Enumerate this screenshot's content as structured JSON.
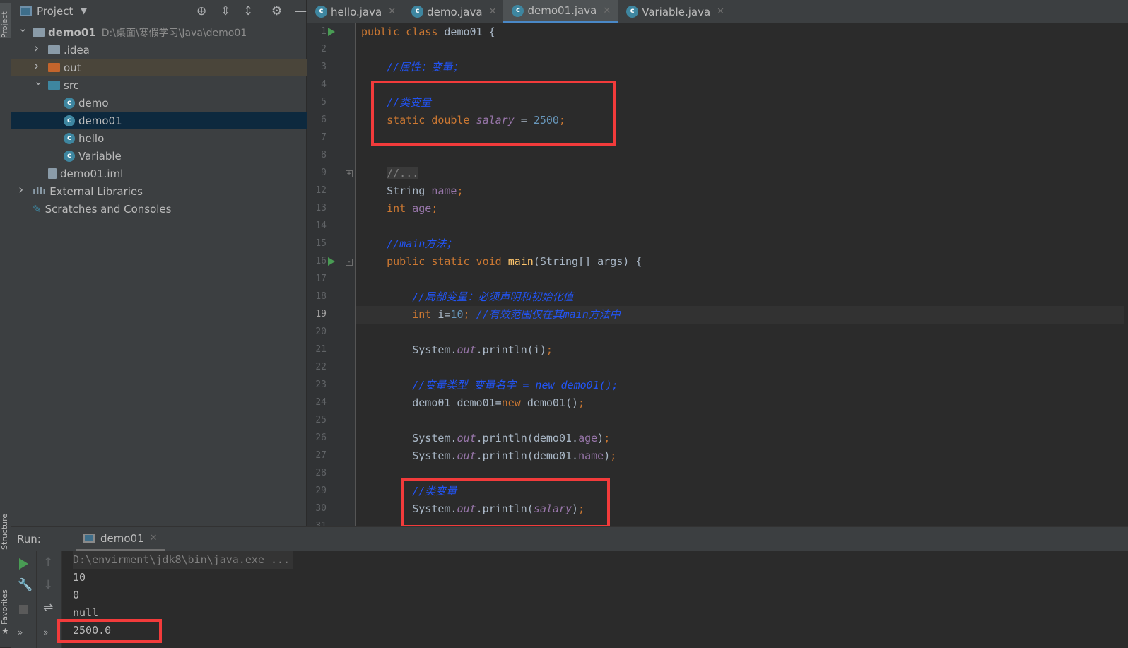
{
  "side_tools": {
    "project": "Project",
    "structure": "Structure",
    "favorites": "Favorites"
  },
  "project_panel": {
    "title": "Project",
    "tree": [
      {
        "label": "demo01",
        "extra": "D:\\桌面\\寒假学习\\Java\\demo01",
        "type": "module",
        "expanded": true,
        "level": 0,
        "bold": true
      },
      {
        "label": ".idea",
        "type": "folder",
        "level": 1,
        "expanded": false
      },
      {
        "label": "out",
        "type": "folder-excluded",
        "level": 1,
        "expanded": false,
        "highlight": true
      },
      {
        "label": "src",
        "type": "folder-source",
        "level": 1,
        "expanded": true
      },
      {
        "label": "demo",
        "type": "class-runnable",
        "level": 2
      },
      {
        "label": "demo01",
        "type": "class-runnable",
        "level": 2,
        "selected": true
      },
      {
        "label": "hello",
        "type": "class-runnable",
        "level": 2
      },
      {
        "label": "Variable",
        "type": "class",
        "level": 2
      },
      {
        "label": "demo01.iml",
        "type": "iml",
        "level": 1
      },
      {
        "label": "External Libraries",
        "type": "libraries",
        "level": 0,
        "expanded": false
      },
      {
        "label": "Scratches and Consoles",
        "type": "scratches",
        "level": 0
      }
    ]
  },
  "tabs": [
    {
      "label": "hello.java",
      "active": false
    },
    {
      "label": "demo.java",
      "active": false
    },
    {
      "label": "demo01.java",
      "active": true
    },
    {
      "label": "Variable.java",
      "active": false
    }
  ],
  "editor": {
    "current_line": 19,
    "lines": [
      {
        "n": "1",
        "run": true,
        "t": [
          [
            "kw",
            "public class "
          ],
          [
            "",
            "demo01 {"
          ]
        ]
      },
      {
        "n": "2",
        "t": []
      },
      {
        "n": "3",
        "t": [
          [
            "",
            "    "
          ],
          [
            "cm",
            "//属性：变量；"
          ]
        ]
      },
      {
        "n": "4",
        "t": []
      },
      {
        "n": "5",
        "t": [
          [
            "",
            "    "
          ],
          [
            "cm",
            "//类变量"
          ]
        ]
      },
      {
        "n": "6",
        "t": [
          [
            "",
            "    "
          ],
          [
            "kw",
            "static double "
          ],
          [
            "sfld",
            "salary"
          ],
          [
            "",
            " = "
          ],
          [
            "num",
            "2500"
          ],
          [
            "sem",
            ";"
          ]
        ]
      },
      {
        "n": "7",
        "t": []
      },
      {
        "n": "8",
        "t": []
      },
      {
        "n": "9",
        "fold": "+",
        "t": [
          [
            "",
            "    "
          ],
          [
            "fc",
            "//..."
          ]
        ]
      },
      {
        "n": "12",
        "t": [
          [
            "",
            "    String "
          ],
          [
            "fld",
            "name"
          ],
          [
            "sem",
            ";"
          ]
        ]
      },
      {
        "n": "13",
        "t": [
          [
            "",
            "    "
          ],
          [
            "kw",
            "int "
          ],
          [
            "fld",
            "age"
          ],
          [
            "sem",
            ";"
          ]
        ]
      },
      {
        "n": "14",
        "t": []
      },
      {
        "n": "15",
        "t": [
          [
            "",
            "    "
          ],
          [
            "cm",
            "//main方法；"
          ]
        ]
      },
      {
        "n": "16",
        "run": true,
        "fold": "-",
        "t": [
          [
            "",
            "    "
          ],
          [
            "kw",
            "public static void "
          ],
          [
            "fn",
            "main"
          ],
          [
            "",
            "(String[] args) {"
          ]
        ]
      },
      {
        "n": "17",
        "t": []
      },
      {
        "n": "18",
        "t": [
          [
            "",
            "        "
          ],
          [
            "cm",
            "//局部变量：必须声明和初始化值"
          ]
        ]
      },
      {
        "n": "19",
        "t": [
          [
            "",
            "        "
          ],
          [
            "kw",
            "int "
          ],
          [
            "",
            "i="
          ],
          [
            "num",
            "10"
          ],
          [
            "sem",
            "; "
          ],
          [
            "cm",
            "//有效范围仅在其main方法中"
          ]
        ]
      },
      {
        "n": "20",
        "t": []
      },
      {
        "n": "21",
        "t": [
          [
            "",
            "        System."
          ],
          [
            "sfld",
            "out"
          ],
          [
            "",
            ".println(i)"
          ],
          [
            "sem",
            ";"
          ]
        ]
      },
      {
        "n": "22",
        "t": []
      },
      {
        "n": "23",
        "t": [
          [
            "",
            "        "
          ],
          [
            "cm",
            "//变量类型 变量名字 = new demo01();"
          ]
        ]
      },
      {
        "n": "24",
        "t": [
          [
            "",
            "        demo01 demo01="
          ],
          [
            "kw",
            "new "
          ],
          [
            "",
            "demo01()"
          ],
          [
            "sem",
            ";"
          ]
        ]
      },
      {
        "n": "25",
        "t": []
      },
      {
        "n": "26",
        "t": [
          [
            "",
            "        System."
          ],
          [
            "sfld",
            "out"
          ],
          [
            "",
            ".println(demo01."
          ],
          [
            "fld",
            "age"
          ],
          [
            "",
            ")"
          ],
          [
            "sem",
            ";"
          ]
        ]
      },
      {
        "n": "27",
        "t": [
          [
            "",
            "        System."
          ],
          [
            "sfld",
            "out"
          ],
          [
            "",
            ".println(demo01."
          ],
          [
            "fld",
            "name"
          ],
          [
            "",
            ")"
          ],
          [
            "sem",
            ";"
          ]
        ]
      },
      {
        "n": "28",
        "t": []
      },
      {
        "n": "29",
        "t": [
          [
            "",
            "        "
          ],
          [
            "cm",
            "//类变量"
          ]
        ]
      },
      {
        "n": "30",
        "t": [
          [
            "",
            "        System."
          ],
          [
            "sfld",
            "out"
          ],
          [
            "",
            ".println("
          ],
          [
            "sfld",
            "salary"
          ],
          [
            "",
            ")"
          ],
          [
            "sem",
            ";"
          ]
        ]
      },
      {
        "n": "31",
        "t": []
      }
    ]
  },
  "run_panel": {
    "label": "Run:",
    "tab": "demo01",
    "output": [
      "D:\\envirment\\jdk8\\bin\\java.exe ...",
      "10",
      "0",
      "null",
      "2500.0"
    ]
  },
  "colors": {
    "highlight_box": "#F23B3B",
    "keyword": "#CC7832",
    "comment": "#2254F4",
    "field": "#9876AA",
    "number": "#6897BB",
    "selection": "#0D293E"
  }
}
